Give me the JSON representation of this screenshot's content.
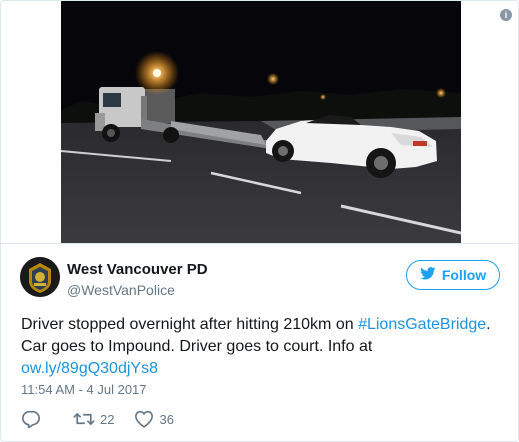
{
  "tweet": {
    "author_name": "West Vancouver PD",
    "author_handle": "@WestVanPolice",
    "follow_label": "Follow",
    "text_1": "Driver stopped overnight after hitting 210km on ",
    "hashtag": "#LionsGateBridge",
    "text_2": ". Car goes to Impound. Driver goes to court. Info at",
    "link": "ow.ly/89gQ30djYs8",
    "timestamp": "11:54 AM - 4 Jul 2017",
    "retweet_count": "22",
    "like_count": "36"
  },
  "icons": {
    "info": "info-icon",
    "follow": "twitter-bird-icon",
    "reply": "reply-icon",
    "retweet": "retweet-icon",
    "like": "heart-icon"
  },
  "colors": {
    "accent": "#1da1f2",
    "link": "#1b95e0",
    "text": "#14171a",
    "muted": "#657786",
    "border": "#e1e8ed"
  }
}
